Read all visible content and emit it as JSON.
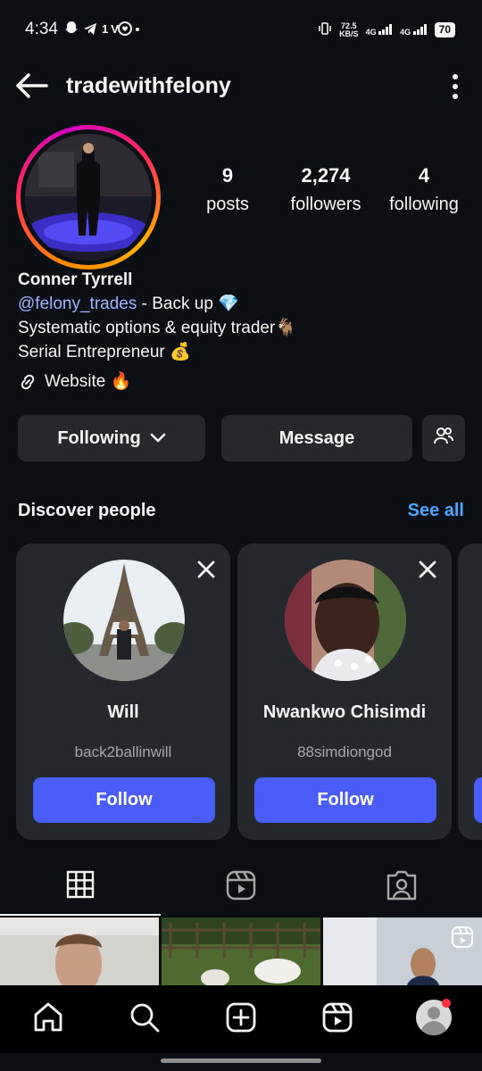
{
  "status_bar": {
    "time": "4:34",
    "left_icons": [
      "snapchat-icon",
      "telegram-icon",
      "tv-icon",
      "chat-icon",
      "dot-icon"
    ],
    "speed_top": "72.5",
    "speed_bottom": "KB/S",
    "net1": "4G",
    "net2": "4G",
    "battery": "70"
  },
  "header": {
    "title": "tradewithfelony"
  },
  "profile": {
    "stats": [
      {
        "value": "9",
        "label": "posts"
      },
      {
        "value": "2,274",
        "label": "followers"
      },
      {
        "value": "4",
        "label": "following"
      }
    ],
    "name": "Conner Tyrrell",
    "handle": "@felony_trades",
    "bio_line1_rest": " - Back up 💎",
    "bio_line2": "Systematic options & equity trader🐐",
    "bio_line3": "Serial Entrepreneur 💰",
    "website": "Website 🔥"
  },
  "actions": {
    "following": "Following",
    "message": "Message"
  },
  "discover": {
    "title": "Discover people",
    "see_all": "See all",
    "cards": [
      {
        "name": "Will",
        "username": "back2ballinwill",
        "follow": "Follow"
      },
      {
        "name": "Nwankwo Chisimdi",
        "username": "88simdiongod",
        "follow": "Follow"
      }
    ]
  },
  "tabs": [
    "grid-icon",
    "reels-icon",
    "tagged-icon"
  ],
  "bottom_nav": [
    "home-icon",
    "search-icon",
    "create-icon",
    "reels-icon",
    "profile-avatar"
  ],
  "colors": {
    "background": "#0c1014",
    "accent_blue": "#4a5df9",
    "link_blue": "#4aa6ff",
    "button_gray": "#25292e"
  }
}
